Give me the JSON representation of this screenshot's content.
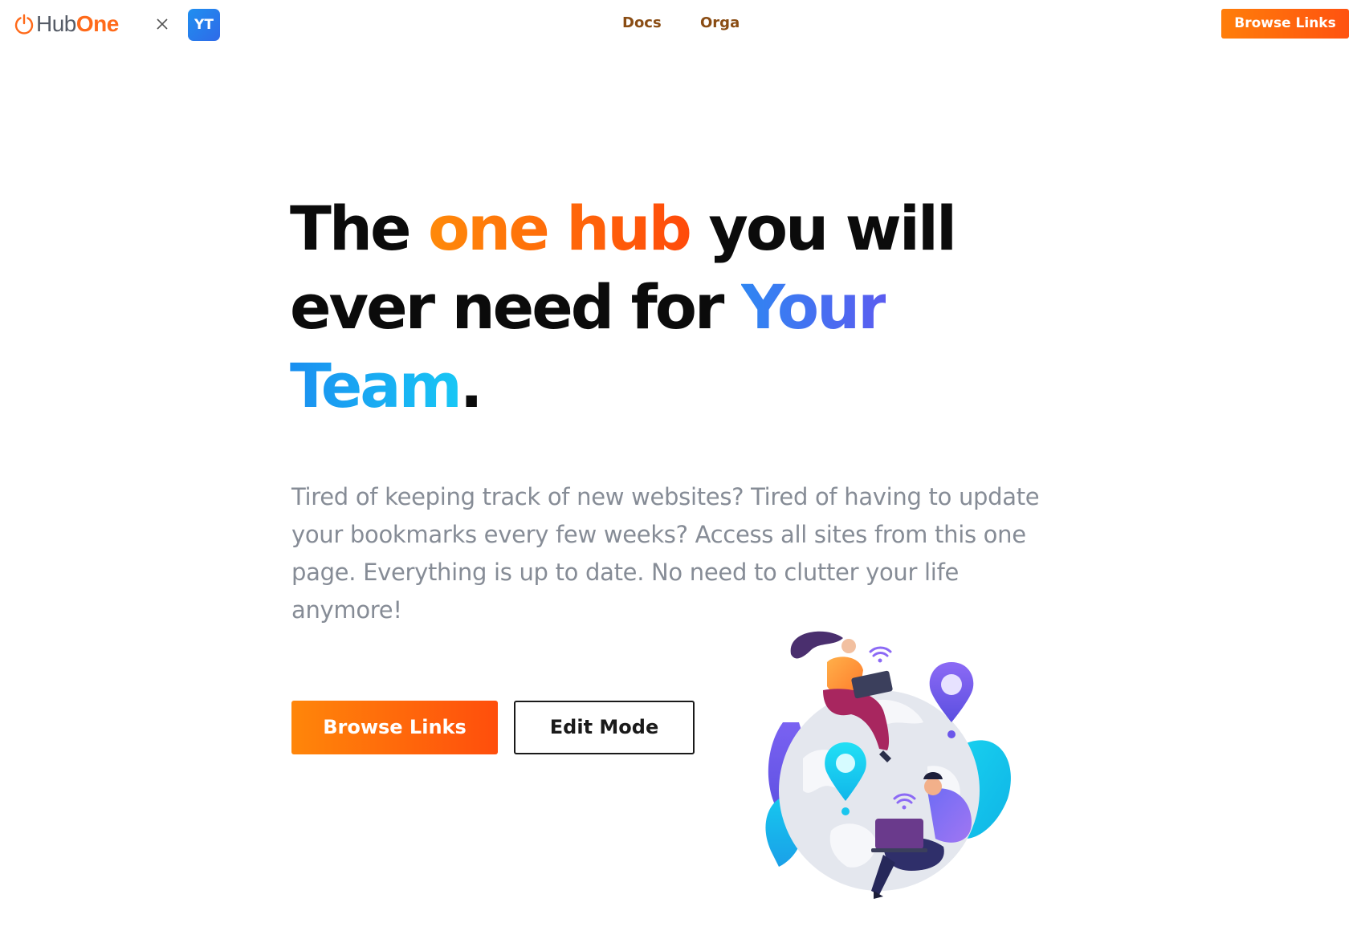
{
  "nav": {
    "logo": {
      "hub": "Hub",
      "one": "One"
    },
    "partner_badge": "YT",
    "links": [
      {
        "label": "Docs"
      },
      {
        "label": "Orga"
      }
    ],
    "cta_label": "Browse Links"
  },
  "hero": {
    "headline": {
      "part1": "The ",
      "highlight1": "one hub",
      "part2": " you will ever need for ",
      "highlight2": "Your",
      "highlight3": "Team",
      "end": "."
    },
    "description": "Tired of keeping track of new websites? Tired of having to update your bookmarks every few weeks? Access all sites from this one page. Everything is up to date. No need to clutter your life anymore!",
    "primary_button": "Browse Links",
    "secondary_button": "Edit Mode"
  },
  "colors": {
    "accent_orange": "#ff6a1a",
    "accent_blue": "#4a64ee",
    "accent_cyan": "#1e9ff5",
    "nav_link": "#8a4d14",
    "body_text": "#868c96"
  },
  "icons": [
    "power-icon",
    "close-icon",
    "world-map-illustration"
  ]
}
